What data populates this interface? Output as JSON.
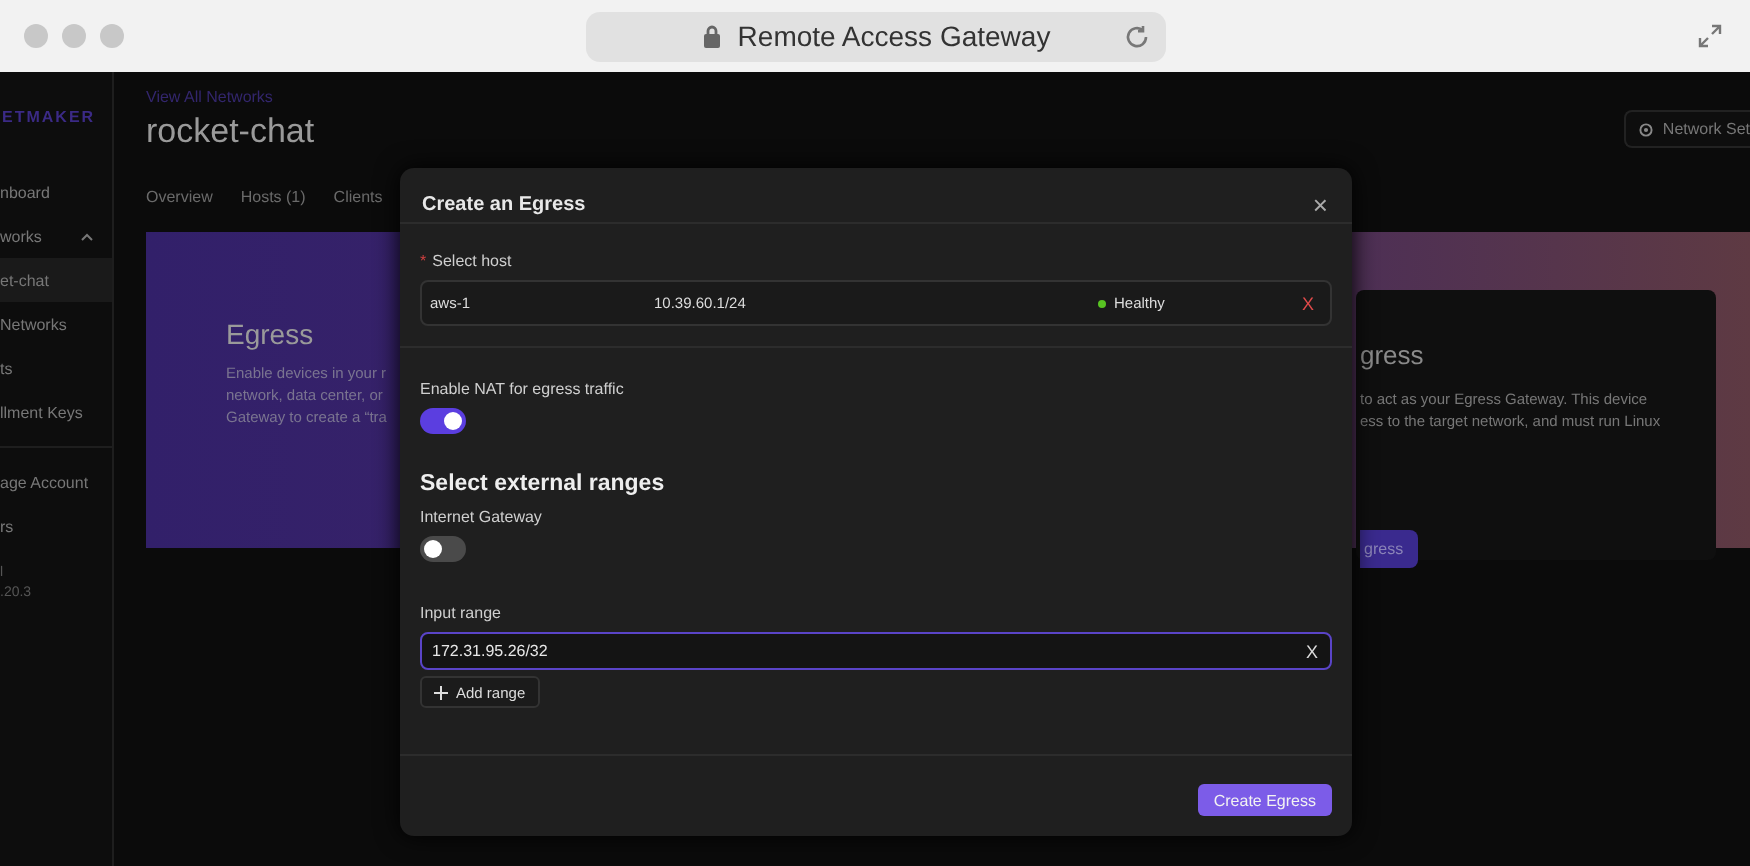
{
  "browser": {
    "address": "Remote Access Gateway"
  },
  "sidebar": {
    "logo": "ETMAKER",
    "items": [
      {
        "kind": "link",
        "label": "nboard"
      },
      {
        "kind": "group",
        "label": "works",
        "expanded": true,
        "children": [
          {
            "label": "et-chat",
            "selected": true
          },
          {
            "label": "Networks",
            "selected": false
          }
        ]
      },
      {
        "kind": "link",
        "label": "ts"
      },
      {
        "kind": "link",
        "label": "llment Keys"
      }
    ],
    "footer_items": [
      {
        "label": "age Account"
      },
      {
        "label": "rs"
      }
    ],
    "version": {
      "name": "l",
      "number": ".20.3"
    }
  },
  "header": {
    "breadcrumb": "View All Networks",
    "title": "rocket-chat",
    "settings_button": "Network Set"
  },
  "tabs": [
    {
      "label": "Overview"
    },
    {
      "label": "Hosts (1)"
    },
    {
      "label": "Clients"
    }
  ],
  "banner": {
    "title": "Egress",
    "lines": [
      "Enable devices in your r",
      "network, data center, or",
      "Gateway to create a “tra"
    ],
    "card": {
      "title": "gress",
      "lines": [
        "to act as your Egress Gateway. This device",
        "ess to the target network, and must run Linux"
      ],
      "button": "gress"
    }
  },
  "modal": {
    "title": "Create an Egress",
    "close": "×",
    "host": {
      "label": "Select host",
      "required": "*",
      "name": "aws-1",
      "address": "10.39.60.1/24",
      "status": "Healthy",
      "clear": "X"
    },
    "nat": {
      "label": "Enable NAT for egress traffic",
      "on": true
    },
    "section": "Select external ranges",
    "gateway": {
      "label": "Internet Gateway",
      "on": false
    },
    "range": {
      "label": "Input range",
      "value": "172.31.95.26/32",
      "clear": "X",
      "add": "Add range"
    },
    "submit": "Create Egress"
  }
}
